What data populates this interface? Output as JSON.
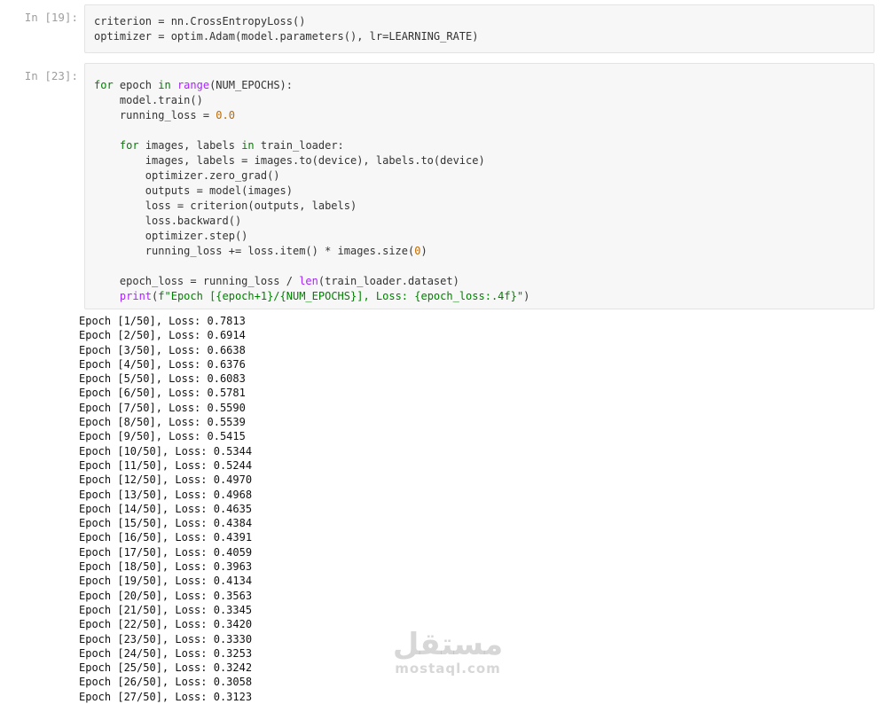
{
  "cells": [
    {
      "prompt": "In [19]:",
      "lines": [
        [
          {
            "t": "criterion = nn.CrossEntropyLoss()",
            "c": ""
          }
        ],
        [
          {
            "t": "optimizer = optim.Adam(model.parameters(), lr=LEARNING_RATE)",
            "c": ""
          }
        ]
      ]
    },
    {
      "prompt": "In [23]:",
      "lines": [
        [
          {
            "t": "for",
            "c": "kw"
          },
          {
            "t": " epoch ",
            "c": ""
          },
          {
            "t": "in",
            "c": "kw"
          },
          {
            "t": " ",
            "c": ""
          },
          {
            "t": "range",
            "c": "bi"
          },
          {
            "t": "(NUM_EPOCHS):",
            "c": ""
          }
        ],
        [
          {
            "t": "    model.train()",
            "c": ""
          }
        ],
        [
          {
            "t": "    running_loss = ",
            "c": ""
          },
          {
            "t": "0.0",
            "c": "num"
          }
        ],
        [
          {
            "t": "",
            "c": ""
          }
        ],
        [
          {
            "t": "    ",
            "c": ""
          },
          {
            "t": "for",
            "c": "kw"
          },
          {
            "t": " images, labels ",
            "c": ""
          },
          {
            "t": "in",
            "c": "kw"
          },
          {
            "t": " train_loader:",
            "c": ""
          }
        ],
        [
          {
            "t": "        images, labels = images.to(device), labels.to(device)",
            "c": ""
          }
        ],
        [
          {
            "t": "        optimizer.zero_grad()",
            "c": ""
          }
        ],
        [
          {
            "t": "        outputs = model(images)",
            "c": ""
          }
        ],
        [
          {
            "t": "        loss = criterion(outputs, labels)",
            "c": ""
          }
        ],
        [
          {
            "t": "        loss.backward()",
            "c": ""
          }
        ],
        [
          {
            "t": "        optimizer.step()",
            "c": ""
          }
        ],
        [
          {
            "t": "        running_loss += loss.item() * images.size(",
            "c": ""
          },
          {
            "t": "0",
            "c": "num"
          },
          {
            "t": ")",
            "c": ""
          }
        ],
        [
          {
            "t": "",
            "c": ""
          }
        ],
        [
          {
            "t": "    epoch_loss = running_loss / ",
            "c": ""
          },
          {
            "t": "len",
            "c": "bi"
          },
          {
            "t": "(train_loader.dataset)",
            "c": ""
          }
        ],
        [
          {
            "t": "    ",
            "c": ""
          },
          {
            "t": "print",
            "c": "bi"
          },
          {
            "t": "(",
            "c": ""
          },
          {
            "t": "f\"Epoch [{epoch+1}/{NUM_EPOCHS}], Loss: {epoch_loss:.4f}\"",
            "c": "kw"
          },
          {
            "t": ")",
            "c": ""
          }
        ]
      ]
    }
  ],
  "output_lines": [
    "Epoch [1/50], Loss: 0.7813",
    "Epoch [2/50], Loss: 0.6914",
    "Epoch [3/50], Loss: 0.6638",
    "Epoch [4/50], Loss: 0.6376",
    "Epoch [5/50], Loss: 0.6083",
    "Epoch [6/50], Loss: 0.5781",
    "Epoch [7/50], Loss: 0.5590",
    "Epoch [8/50], Loss: 0.5539",
    "Epoch [9/50], Loss: 0.5415",
    "Epoch [10/50], Loss: 0.5344",
    "Epoch [11/50], Loss: 0.5244",
    "Epoch [12/50], Loss: 0.4970",
    "Epoch [13/50], Loss: 0.4968",
    "Epoch [14/50], Loss: 0.4635",
    "Epoch [15/50], Loss: 0.4384",
    "Epoch [16/50], Loss: 0.4391",
    "Epoch [17/50], Loss: 0.4059",
    "Epoch [18/50], Loss: 0.3963",
    "Epoch [19/50], Loss: 0.4134",
    "Epoch [20/50], Loss: 0.3563",
    "Epoch [21/50], Loss: 0.3345",
    "Epoch [22/50], Loss: 0.3420",
    "Epoch [23/50], Loss: 0.3330",
    "Epoch [24/50], Loss: 0.3253",
    "Epoch [25/50], Loss: 0.3242",
    "Epoch [26/50], Loss: 0.3058",
    "Epoch [27/50], Loss: 0.3123"
  ],
  "watermark": {
    "arabic": "مستقل",
    "latin": "mostaql.com"
  },
  "colors": {
    "keyword": "#008000",
    "builtin": "#aa22ff",
    "number": "#bf6a00",
    "cell_background": "#f7f7f7",
    "cell_border": "#e3e3e3",
    "prompt": "#9e9e9e"
  }
}
